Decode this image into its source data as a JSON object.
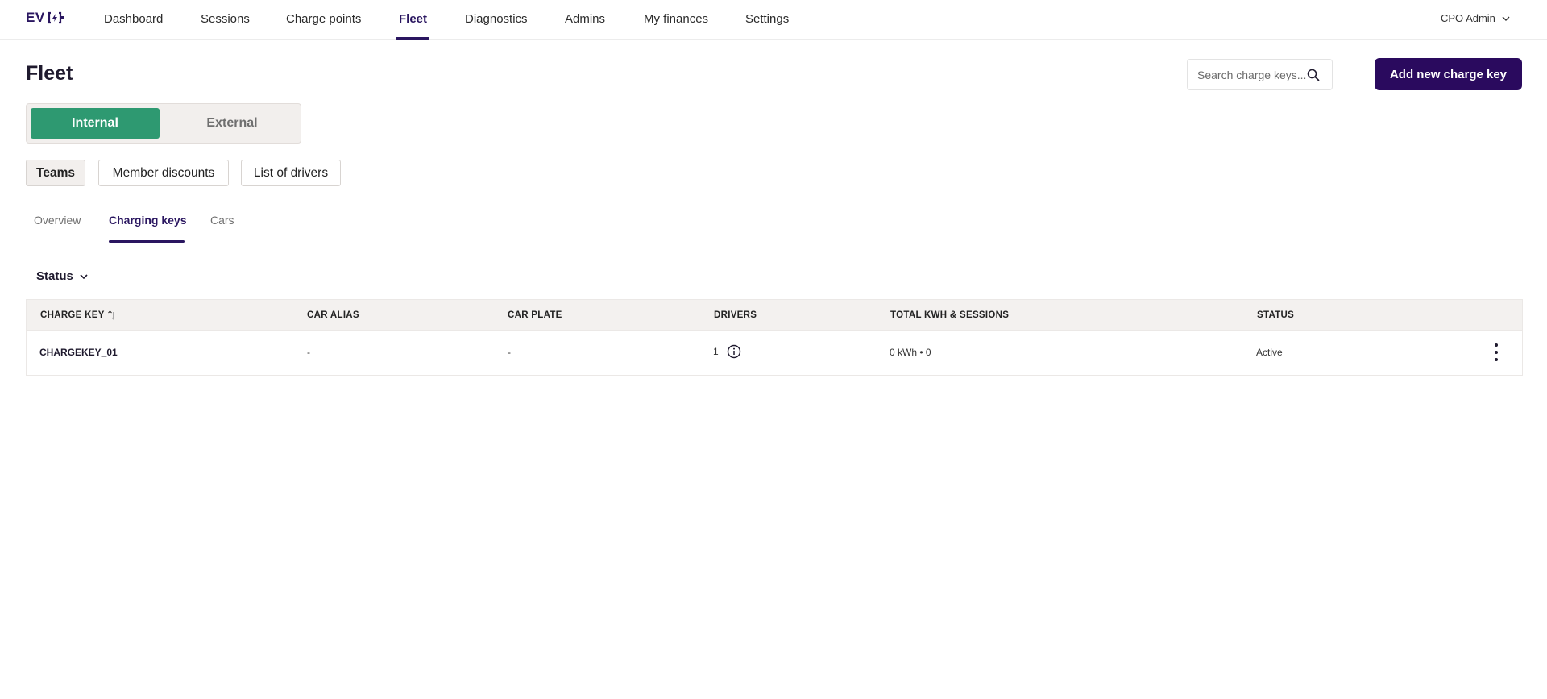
{
  "app": {
    "logo_text": "EV"
  },
  "nav": {
    "items": [
      {
        "label": "Dashboard"
      },
      {
        "label": "Sessions"
      },
      {
        "label": "Charge points"
      },
      {
        "label": "Fleet"
      },
      {
        "label": "Diagnostics"
      },
      {
        "label": "Admins"
      },
      {
        "label": "My finances"
      },
      {
        "label": "Settings"
      }
    ],
    "active": "Fleet",
    "user": "CPO Admin"
  },
  "header": {
    "title": "Fleet",
    "search_placeholder": "Search charge keys...",
    "add_button": "Add new charge key"
  },
  "segmented": {
    "internal": "Internal",
    "external": "External",
    "selected": "Internal"
  },
  "pills": {
    "teams": "Teams",
    "member_discounts": "Member discounts",
    "list_of_drivers": "List of drivers",
    "selected": "Teams"
  },
  "subtabs": {
    "overview": "Overview",
    "charging_keys": "Charging keys",
    "cars": "Cars",
    "selected": "Charging keys"
  },
  "filter": {
    "status": "Status"
  },
  "table": {
    "headers": {
      "charge_key": "CHARGE KEY",
      "car_alias": "CAR ALIAS",
      "car_plate": "CAR PLATE",
      "drivers": "DRIVERS",
      "total": "TOTAL KWH & SESSIONS",
      "status": "STATUS"
    },
    "rows": [
      {
        "charge_key": "CHARGEKEY_01",
        "car_alias": "-",
        "car_plate": "-",
        "drivers": "1",
        "total": "0 kWh • 0",
        "status": "Active"
      }
    ]
  },
  "colors": {
    "brand": "#2a0a5e",
    "accent_green": "#2e9971"
  }
}
